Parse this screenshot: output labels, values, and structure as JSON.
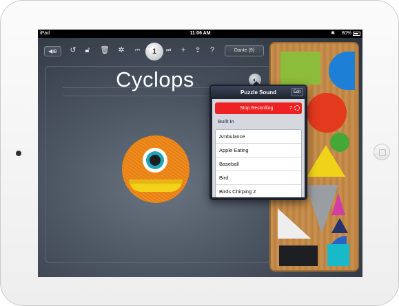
{
  "status_bar": {
    "carrier": "iPad",
    "time": "11:06 AM",
    "battery": "80%"
  },
  "toolbar": {
    "page_number": "1",
    "add_label": "+",
    "help_label": "?",
    "user_button": "Dante (9)"
  },
  "puzzle": {
    "title": "Cyclops"
  },
  "popover": {
    "title": "Puzzle Sound",
    "edit_label": "Edit",
    "stop_recording_label": "Stop Recording",
    "recording_count": "7",
    "section_header": "Built In",
    "sounds": [
      "Ambulance",
      "Apple Eating",
      "Baseball",
      "Bird",
      "Birds Chirping 2"
    ]
  },
  "colors": {
    "record_red": "#e22222",
    "cyclops_orange": "#ef8d1c",
    "eye_teal": "#1fa6b8"
  }
}
